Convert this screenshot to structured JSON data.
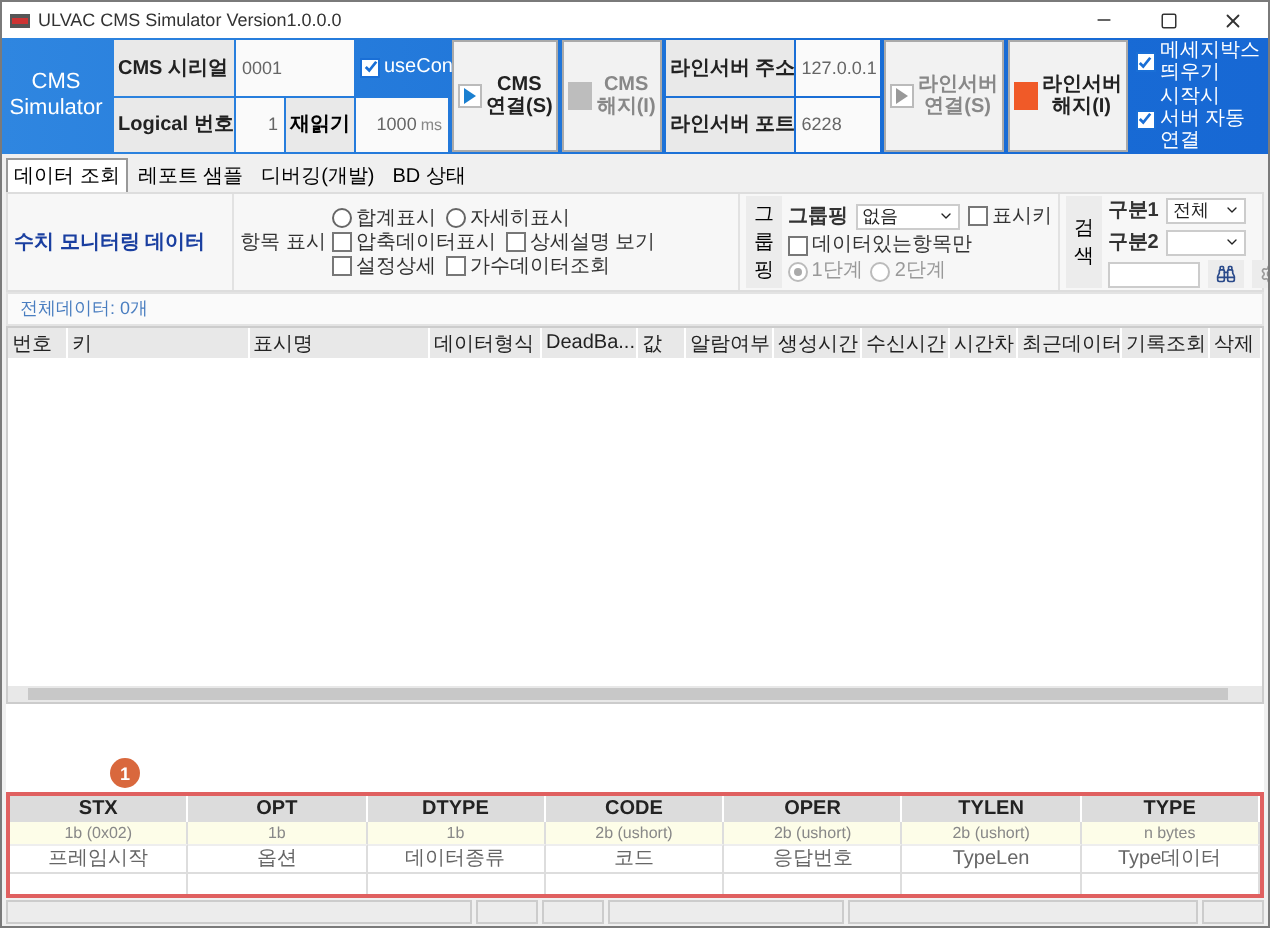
{
  "window": {
    "title": "ULVAC CMS Simulator Version1.0.0.0"
  },
  "header": {
    "logo": [
      "CMS",
      "Simulator"
    ],
    "cms_serial": {
      "label": "CMS 시리얼",
      "value": "0001"
    },
    "use_con": {
      "label": "useCon",
      "checked": true
    },
    "logical_no": {
      "label": "Logical 번호",
      "value": "1"
    },
    "reread_button": "재읽기",
    "interval": {
      "value": "1000",
      "unit": "ms"
    },
    "cms_buttons": [
      {
        "kind": "connect",
        "lines": [
          "CMS",
          "연결(S)"
        ],
        "disabled": false
      },
      {
        "kind": "disconnect",
        "lines": [
          "CMS",
          "해지(I)"
        ],
        "disabled": true
      }
    ],
    "line_server": [
      {
        "label": "라인서버 주소",
        "value": "127.0.0.1"
      },
      {
        "label": "라인서버 포트",
        "value": "6228"
      }
    ],
    "line_buttons": [
      {
        "kind": "connect",
        "lines": [
          "라인서버",
          "연결(S)"
        ],
        "disabled": true
      },
      {
        "kind": "disconnect",
        "lines": [
          "라인서버",
          "해지(I)"
        ],
        "disabled": false
      }
    ],
    "options": [
      {
        "label": "메세지박스 띄우기",
        "checked": true
      },
      {
        "label": "시작시 서버 자동 연결",
        "checked": true
      }
    ]
  },
  "tabs": [
    {
      "label": "데이터 조회",
      "selected": true
    },
    {
      "label": "레포트 샘플",
      "selected": false
    },
    {
      "label": "디버깅(개발)",
      "selected": false
    },
    {
      "label": "BD 상태",
      "selected": false
    }
  ],
  "toolbar": {
    "title": "수치 모니터링 데이터",
    "display_label": "항목 표시",
    "display_options": [
      {
        "kind": "radio",
        "label": "합계표시",
        "selected": false
      },
      {
        "kind": "radio",
        "label": "자세히표시",
        "selected": false
      },
      {
        "kind": "checkbox",
        "label": "압축데이터표시",
        "checked": false
      },
      {
        "kind": "checkbox",
        "label": "상세설명 보기",
        "checked": false
      },
      {
        "kind": "checkbox",
        "label": "설정상세",
        "checked": false
      },
      {
        "kind": "checkbox",
        "label": "가수데이터조회",
        "checked": false
      }
    ],
    "group_button": "그룹핑",
    "grouping": {
      "label": "그룹핑",
      "value": "없음"
    },
    "show_key": {
      "label": "표시키",
      "checked": false
    },
    "only_data": {
      "label": "데이터있는항목만",
      "checked": false
    },
    "levels": [
      {
        "label": "1단계",
        "selected": true,
        "disabled": true
      },
      {
        "label": "2단계",
        "selected": false,
        "disabled": true
      }
    ],
    "search_button": "검색",
    "filter1": {
      "label": "구분1",
      "value": "전체"
    },
    "filter2": {
      "label": "구분2"
    }
  },
  "data_count": "전체데이터: 0개",
  "table": {
    "columns": [
      "번호",
      "키",
      "표시명",
      "데이터형식",
      "DeadBa...",
      "값",
      "알람여부",
      "생성시간",
      "수신시간",
      "시간차",
      "최근데이터",
      "기록조회",
      "삭제"
    ]
  },
  "annotation": {
    "label": "1"
  },
  "protocol": {
    "columns": [
      {
        "name": "STX",
        "size": "1b (0x02)",
        "desc": "프레임시작"
      },
      {
        "name": "OPT",
        "size": "1b",
        "desc": "옵션"
      },
      {
        "name": "DTYPE",
        "size": "1b",
        "desc": "데이터종류"
      },
      {
        "name": "CODE",
        "size": "2b (ushort)",
        "desc": "코드"
      },
      {
        "name": "OPER",
        "size": "2b (ushort)",
        "desc": "응답번호"
      },
      {
        "name": "TYLEN",
        "size": "2b (ushort)",
        "desc": "TypeLen"
      },
      {
        "name": "TYPE",
        "size": "n bytes",
        "desc": "Type데이터"
      }
    ]
  }
}
